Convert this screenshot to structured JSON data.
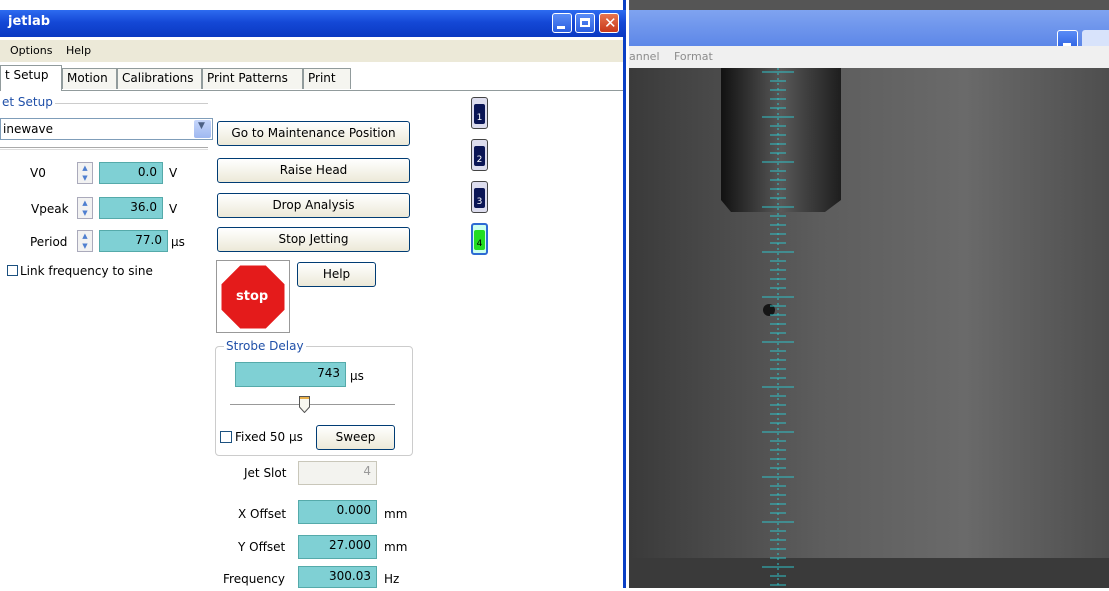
{
  "window": {
    "title": "jetlab"
  },
  "menu": {
    "options": "Options",
    "help": "Help"
  },
  "tabs": [
    "t Setup",
    "Motion",
    "Calibrations",
    "Print Patterns",
    "Print"
  ],
  "jet_setup": {
    "group_label": "et Setup",
    "waveform": "inewave",
    "v0": {
      "label": "V0",
      "value": "0.0",
      "unit": "V"
    },
    "vpeak": {
      "label": "Vpeak",
      "value": "36.0",
      "unit": "V"
    },
    "period": {
      "label": "Period",
      "value": "77.0",
      "unit": "µs"
    },
    "link_label": "Link frequency to sine"
  },
  "buttons": {
    "maintenance": "Go to Maintenance Position",
    "raise": "Raise Head",
    "drop": "Drop Analysis",
    "stop_jetting": "Stop Jetting",
    "help": "Help",
    "stop": "stop",
    "sweep": "Sweep"
  },
  "strobe": {
    "group_label": "Strobe Delay",
    "value": "743",
    "unit": "µs",
    "slider_level": 0.45,
    "fixed_label": "Fixed 50 µs"
  },
  "jet_slot": {
    "label": "Jet Slot",
    "value": "4"
  },
  "x_offset": {
    "label": "X Offset",
    "value": "0.000",
    "unit": "mm"
  },
  "y_offset": {
    "label": "Y Offset",
    "value": "27.000",
    "unit": "mm"
  },
  "frequency": {
    "label": "Frequency",
    "value": "300.03",
    "unit": "Hz"
  },
  "jets": [
    "1",
    "2",
    "3",
    "4"
  ],
  "camera": {
    "menu_channel": "annel",
    "menu_format": "Format"
  },
  "colors": {
    "title_blue": "#1448d6",
    "field_cyan": "#7fd0d4",
    "stop_red": "#e41b1b",
    "active_jet": "#22dd22"
  }
}
